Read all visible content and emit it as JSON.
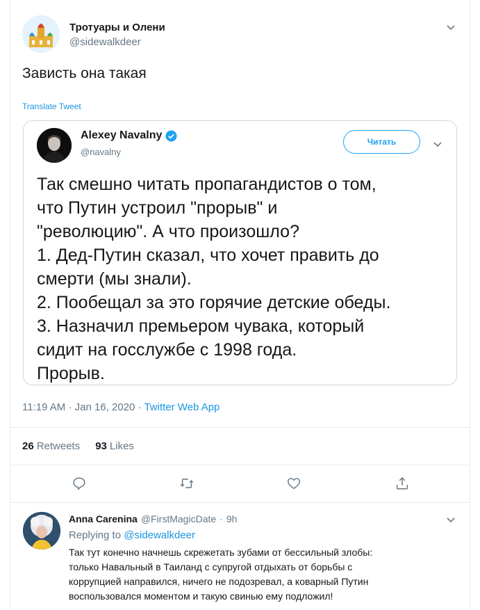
{
  "tweet": {
    "author_name": "Тротуары и Олени",
    "author_handle": "@sidewalkdeer",
    "text": "Зависть она такая",
    "translate_label": "Translate Tweet",
    "time": "11:19 AM",
    "date": "Jan 16, 2020",
    "source": "Twitter Web App",
    "retweets_count": "26",
    "retweets_label": "Retweets",
    "likes_count": "93",
    "likes_label": "Likes"
  },
  "quoted": {
    "author_name": "Alexey Navalny",
    "author_handle": "@navalny",
    "follow_label": "Читать",
    "lines": [
      "Так смешно читать пропагандистов о том,",
      "что Путин устроил \"прорыв\" и",
      "\"революцию\". А что произошло?",
      "1. Дед-Путин сказал, что хочет править до",
      "смерти (мы знали).",
      "2. Пообещал за это горячие детские обеды.",
      "3. Назначил премьером чувака, который",
      "сидит на госслужбе с 1998 года.",
      "Прорыв."
    ]
  },
  "reply": {
    "author_name": "Anna Carenina",
    "author_handle": "@FirstMagicDate",
    "age": "9h",
    "replying_prefix": "Replying to",
    "replying_handle": "@sidewalkdeer",
    "lines": [
      "Так тут конечно начнешь скрежетать зубами от бессильный злобы:",
      "только Навальный в Таиланд с супругой отдыхать от борьбы с",
      "коррупцией направился, ничего не подозревал, а коварный Путин",
      "воспользовался моментом и такую свинью ему подложил!"
    ]
  },
  "icons": {
    "reply": "reply-icon",
    "retweet": "retweet-icon",
    "like": "heart-icon",
    "share": "share-icon",
    "caret": "chevron-down-icon",
    "verified": "verified-badge-icon"
  },
  "colors": {
    "accent": "#1da1f2",
    "link": "#1b95e0",
    "secondary_text": "#657786",
    "border": "#e6ecf0"
  }
}
